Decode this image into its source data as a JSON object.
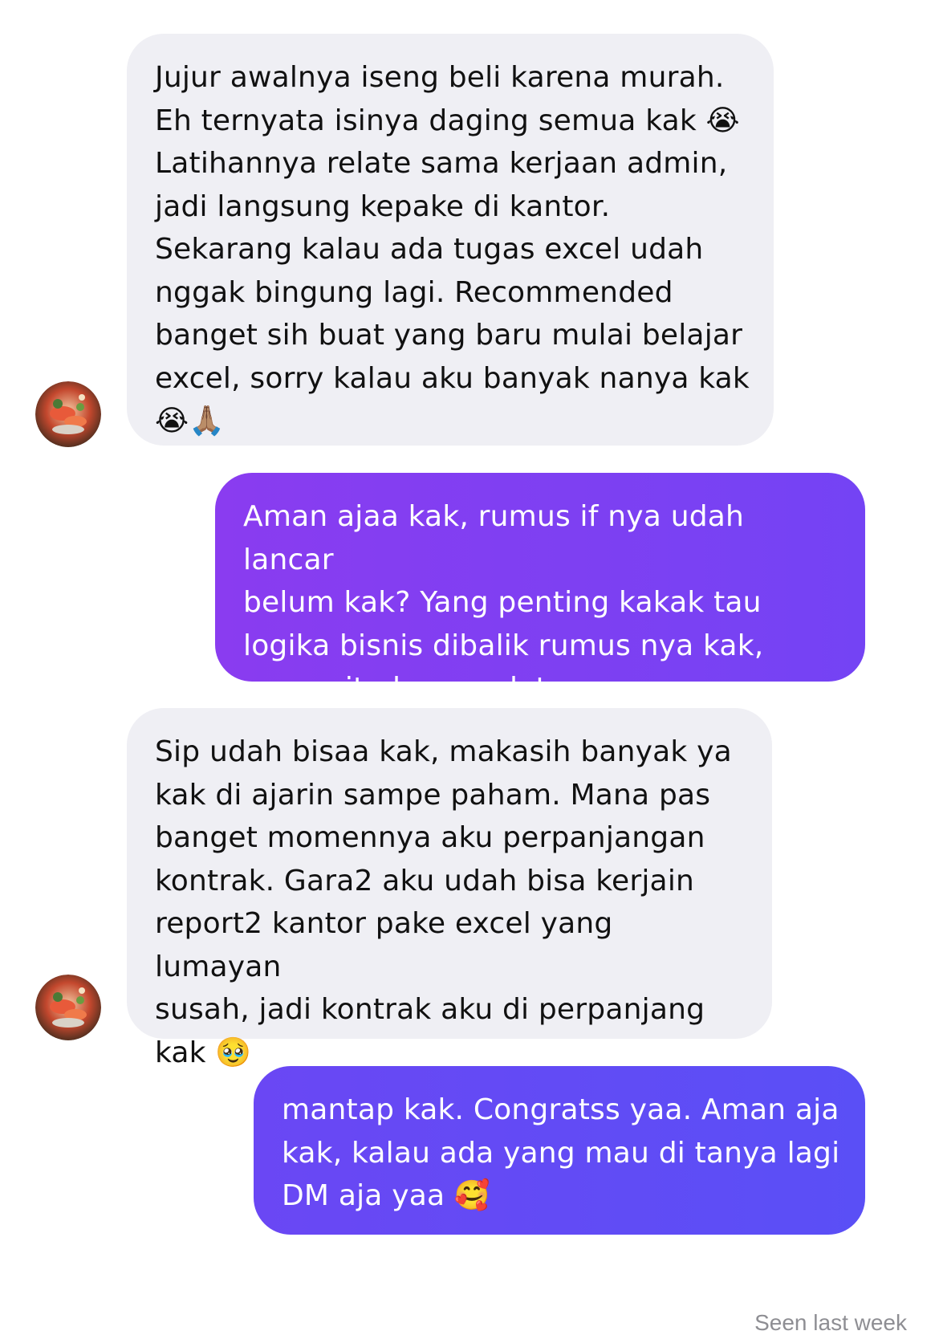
{
  "colors": {
    "incoming_bg": "#efeff4",
    "incoming_text": "#111111",
    "outgoing_grad_1": [
      "#8a3cf0",
      "#7443f4"
    ],
    "outgoing_grad_2": [
      "#6a47f4",
      "#5a4ff6"
    ],
    "seen_text": "#8e8e93"
  },
  "messages": [
    {
      "direction": "incoming",
      "text": "Jujur awalnya iseng beli karena murah.\nEh ternyata isinya daging semua kak 😭\nLatihannya relate sama kerjaan admin,\njadi langsung kepake di kantor.\nSekarang kalau ada tugas excel udah\nnggak bingung lagi. Recommended\nbanget sih buat yang baru mulai belajar\nexcel, sorry kalau aku banyak nanya kak\n😭🙏🏽",
      "avatar": "sender-avatar-icon"
    },
    {
      "direction": "outgoing",
      "text": "Aman ajaa kak, rumus if nya udah lancar\nbelum kak? Yang penting kakak tau\nlogika bisnis dibalik rumus nya kak,\nrumus itu hanya alat"
    },
    {
      "direction": "incoming",
      "text": "Sip udah bisaa kak, makasih banyak ya\nkak di ajarin sampe paham. Mana pas\nbanget momennya aku perpanjangan\nkontrak. Gara2 aku udah bisa kerjain\nreport2 kantor pake excel yang lumayan\nsusah, jadi kontrak aku di perpanjang\nkak 🥹",
      "avatar": "sender-avatar-icon"
    },
    {
      "direction": "outgoing",
      "text": "mantap kak. Congratss yaa. Aman aja\nkak, kalau ada yang mau di tanya lagi\nDM aja yaa 🥰"
    }
  ],
  "status": {
    "seen_label": "Seen last week"
  }
}
